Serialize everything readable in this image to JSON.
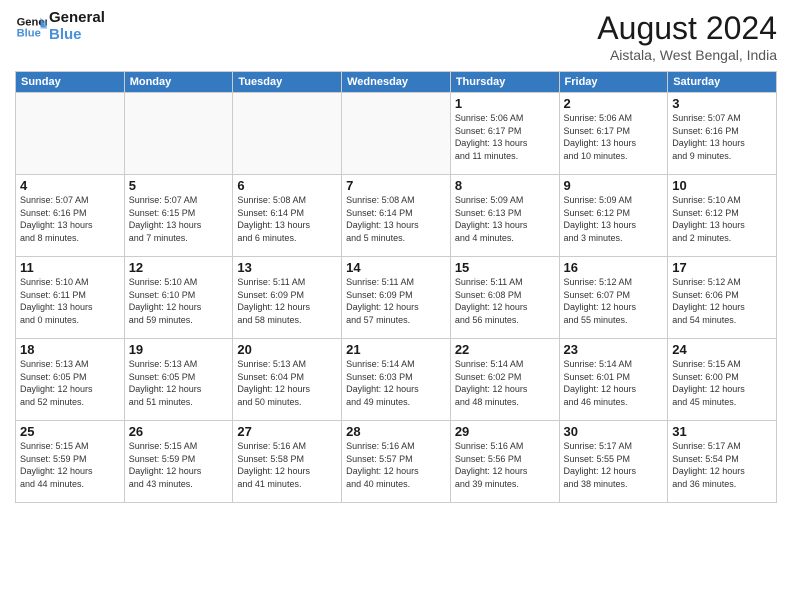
{
  "logo": {
    "line1": "General",
    "line2": "Blue"
  },
  "title": "August 2024",
  "location": "Aistala, West Bengal, India",
  "headers": [
    "Sunday",
    "Monday",
    "Tuesday",
    "Wednesday",
    "Thursday",
    "Friday",
    "Saturday"
  ],
  "weeks": [
    [
      {
        "num": "",
        "info": ""
      },
      {
        "num": "",
        "info": ""
      },
      {
        "num": "",
        "info": ""
      },
      {
        "num": "",
        "info": ""
      },
      {
        "num": "1",
        "info": "Sunrise: 5:06 AM\nSunset: 6:17 PM\nDaylight: 13 hours\nand 11 minutes."
      },
      {
        "num": "2",
        "info": "Sunrise: 5:06 AM\nSunset: 6:17 PM\nDaylight: 13 hours\nand 10 minutes."
      },
      {
        "num": "3",
        "info": "Sunrise: 5:07 AM\nSunset: 6:16 PM\nDaylight: 13 hours\nand 9 minutes."
      }
    ],
    [
      {
        "num": "4",
        "info": "Sunrise: 5:07 AM\nSunset: 6:16 PM\nDaylight: 13 hours\nand 8 minutes."
      },
      {
        "num": "5",
        "info": "Sunrise: 5:07 AM\nSunset: 6:15 PM\nDaylight: 13 hours\nand 7 minutes."
      },
      {
        "num": "6",
        "info": "Sunrise: 5:08 AM\nSunset: 6:14 PM\nDaylight: 13 hours\nand 6 minutes."
      },
      {
        "num": "7",
        "info": "Sunrise: 5:08 AM\nSunset: 6:14 PM\nDaylight: 13 hours\nand 5 minutes."
      },
      {
        "num": "8",
        "info": "Sunrise: 5:09 AM\nSunset: 6:13 PM\nDaylight: 13 hours\nand 4 minutes."
      },
      {
        "num": "9",
        "info": "Sunrise: 5:09 AM\nSunset: 6:12 PM\nDaylight: 13 hours\nand 3 minutes."
      },
      {
        "num": "10",
        "info": "Sunrise: 5:10 AM\nSunset: 6:12 PM\nDaylight: 13 hours\nand 2 minutes."
      }
    ],
    [
      {
        "num": "11",
        "info": "Sunrise: 5:10 AM\nSunset: 6:11 PM\nDaylight: 13 hours\nand 0 minutes."
      },
      {
        "num": "12",
        "info": "Sunrise: 5:10 AM\nSunset: 6:10 PM\nDaylight: 12 hours\nand 59 minutes."
      },
      {
        "num": "13",
        "info": "Sunrise: 5:11 AM\nSunset: 6:09 PM\nDaylight: 12 hours\nand 58 minutes."
      },
      {
        "num": "14",
        "info": "Sunrise: 5:11 AM\nSunset: 6:09 PM\nDaylight: 12 hours\nand 57 minutes."
      },
      {
        "num": "15",
        "info": "Sunrise: 5:11 AM\nSunset: 6:08 PM\nDaylight: 12 hours\nand 56 minutes."
      },
      {
        "num": "16",
        "info": "Sunrise: 5:12 AM\nSunset: 6:07 PM\nDaylight: 12 hours\nand 55 minutes."
      },
      {
        "num": "17",
        "info": "Sunrise: 5:12 AM\nSunset: 6:06 PM\nDaylight: 12 hours\nand 54 minutes."
      }
    ],
    [
      {
        "num": "18",
        "info": "Sunrise: 5:13 AM\nSunset: 6:05 PM\nDaylight: 12 hours\nand 52 minutes."
      },
      {
        "num": "19",
        "info": "Sunrise: 5:13 AM\nSunset: 6:05 PM\nDaylight: 12 hours\nand 51 minutes."
      },
      {
        "num": "20",
        "info": "Sunrise: 5:13 AM\nSunset: 6:04 PM\nDaylight: 12 hours\nand 50 minutes."
      },
      {
        "num": "21",
        "info": "Sunrise: 5:14 AM\nSunset: 6:03 PM\nDaylight: 12 hours\nand 49 minutes."
      },
      {
        "num": "22",
        "info": "Sunrise: 5:14 AM\nSunset: 6:02 PM\nDaylight: 12 hours\nand 48 minutes."
      },
      {
        "num": "23",
        "info": "Sunrise: 5:14 AM\nSunset: 6:01 PM\nDaylight: 12 hours\nand 46 minutes."
      },
      {
        "num": "24",
        "info": "Sunrise: 5:15 AM\nSunset: 6:00 PM\nDaylight: 12 hours\nand 45 minutes."
      }
    ],
    [
      {
        "num": "25",
        "info": "Sunrise: 5:15 AM\nSunset: 5:59 PM\nDaylight: 12 hours\nand 44 minutes."
      },
      {
        "num": "26",
        "info": "Sunrise: 5:15 AM\nSunset: 5:59 PM\nDaylight: 12 hours\nand 43 minutes."
      },
      {
        "num": "27",
        "info": "Sunrise: 5:16 AM\nSunset: 5:58 PM\nDaylight: 12 hours\nand 41 minutes."
      },
      {
        "num": "28",
        "info": "Sunrise: 5:16 AM\nSunset: 5:57 PM\nDaylight: 12 hours\nand 40 minutes."
      },
      {
        "num": "29",
        "info": "Sunrise: 5:16 AM\nSunset: 5:56 PM\nDaylight: 12 hours\nand 39 minutes."
      },
      {
        "num": "30",
        "info": "Sunrise: 5:17 AM\nSunset: 5:55 PM\nDaylight: 12 hours\nand 38 minutes."
      },
      {
        "num": "31",
        "info": "Sunrise: 5:17 AM\nSunset: 5:54 PM\nDaylight: 12 hours\nand 36 minutes."
      }
    ]
  ]
}
